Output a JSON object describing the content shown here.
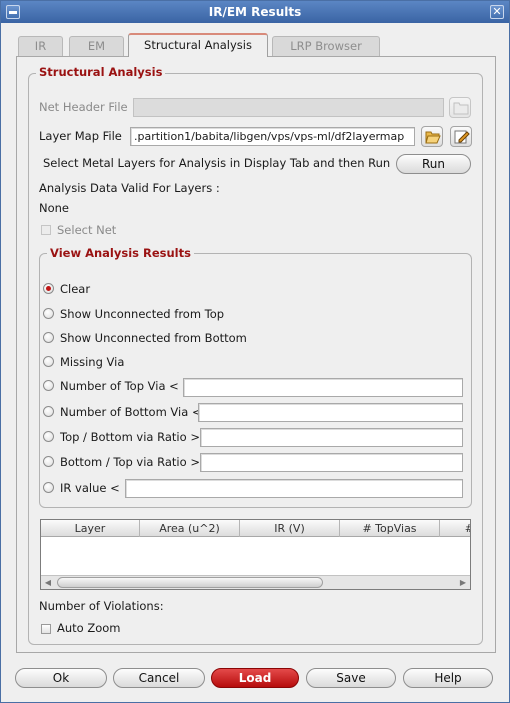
{
  "window": {
    "title": "IR/EM Results"
  },
  "tabs": [
    {
      "label": "IR"
    },
    {
      "label": "EM"
    },
    {
      "label": "Structural Analysis"
    },
    {
      "label": "LRP Browser"
    }
  ],
  "structural": {
    "title": "Structural Analysis",
    "net_header_label": "Net Header File",
    "net_header_value": "",
    "layer_map_label": "Layer Map File",
    "layer_map_value": ".partition1/babita/libgen/vps/vps-ml/df2layermap",
    "select_layers_text": "Select Metal Layers for Analysis in Display Tab and then Run",
    "run_label": "Run",
    "valid_layers_label": "Analysis Data Valid For Layers :",
    "valid_layers_value": "None",
    "select_net_label": "Select Net"
  },
  "view_results": {
    "title": "View Analysis Results",
    "options": [
      {
        "label": "Clear",
        "checked": true
      },
      {
        "label": "Show Unconnected from Top"
      },
      {
        "label": "Show Unconnected from Bottom"
      },
      {
        "label": "Missing Via"
      },
      {
        "label": "Number of Top Via <",
        "value": ""
      },
      {
        "label": "Number of Bottom Via <",
        "value": ""
      },
      {
        "label": "Top / Bottom via Ratio >",
        "value": ""
      },
      {
        "label": "Bottom / Top via Ratio >",
        "value": ""
      },
      {
        "label": "IR value <",
        "value": ""
      }
    ]
  },
  "results_table": {
    "columns": [
      "Layer",
      "Area (u^2)",
      "IR (V)",
      "# TopVias",
      "#"
    ]
  },
  "violations_label": "Number of Violations:",
  "auto_zoom_label": "Auto Zoom",
  "footer": {
    "ok": "Ok",
    "cancel": "Cancel",
    "load": "Load",
    "save": "Save",
    "help": "Help"
  }
}
